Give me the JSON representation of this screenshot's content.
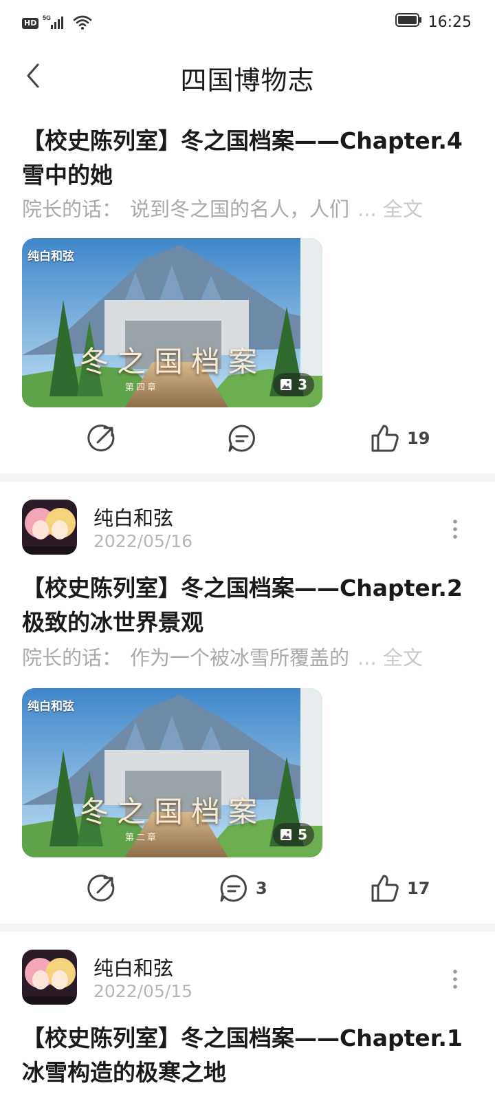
{
  "status_bar": {
    "network": "5G",
    "hd": "HD",
    "time": "16:25"
  },
  "nav": {
    "title": "四国博物志"
  },
  "posts": [
    {
      "title": "【校史陈列室】冬之国档案——Chapter.4雪中的她",
      "excerpt_label": "院长的话：",
      "excerpt_text": "说到冬之国的名人，人们",
      "excerpt_more": "... 全文",
      "thumb_logo": "纯白和弦",
      "thumb_banner": "冬之国档案",
      "thumb_chapter": "第四章",
      "image_count": "3",
      "comments": "",
      "likes": "19"
    },
    {
      "author": "纯白和弦",
      "date": "2022/05/16",
      "title": "【校史陈列室】冬之国档案——Chapter.2极致的冰世界景观",
      "excerpt_label": "院长的话：",
      "excerpt_text": "作为一个被冰雪所覆盖的",
      "excerpt_more": "... 全文",
      "thumb_logo": "纯白和弦",
      "thumb_banner": "冬之国档案",
      "thumb_chapter": "第二章",
      "image_count": "5",
      "comments": "3",
      "likes": "17"
    },
    {
      "author": "纯白和弦",
      "date": "2022/05/15",
      "title": "【校史陈列室】冬之国档案——Chapter.1冰雪构造的极寒之地"
    }
  ],
  "icons": {
    "back": "chevron-left-icon",
    "share": "share-icon",
    "comment": "comment-icon",
    "like": "thumbs-up-icon",
    "more": "more-vertical-icon",
    "image": "image-icon"
  },
  "colors": {
    "secondary_text": "#a9a9a9",
    "divider": "#f3f4f6",
    "icon": "#444444"
  }
}
